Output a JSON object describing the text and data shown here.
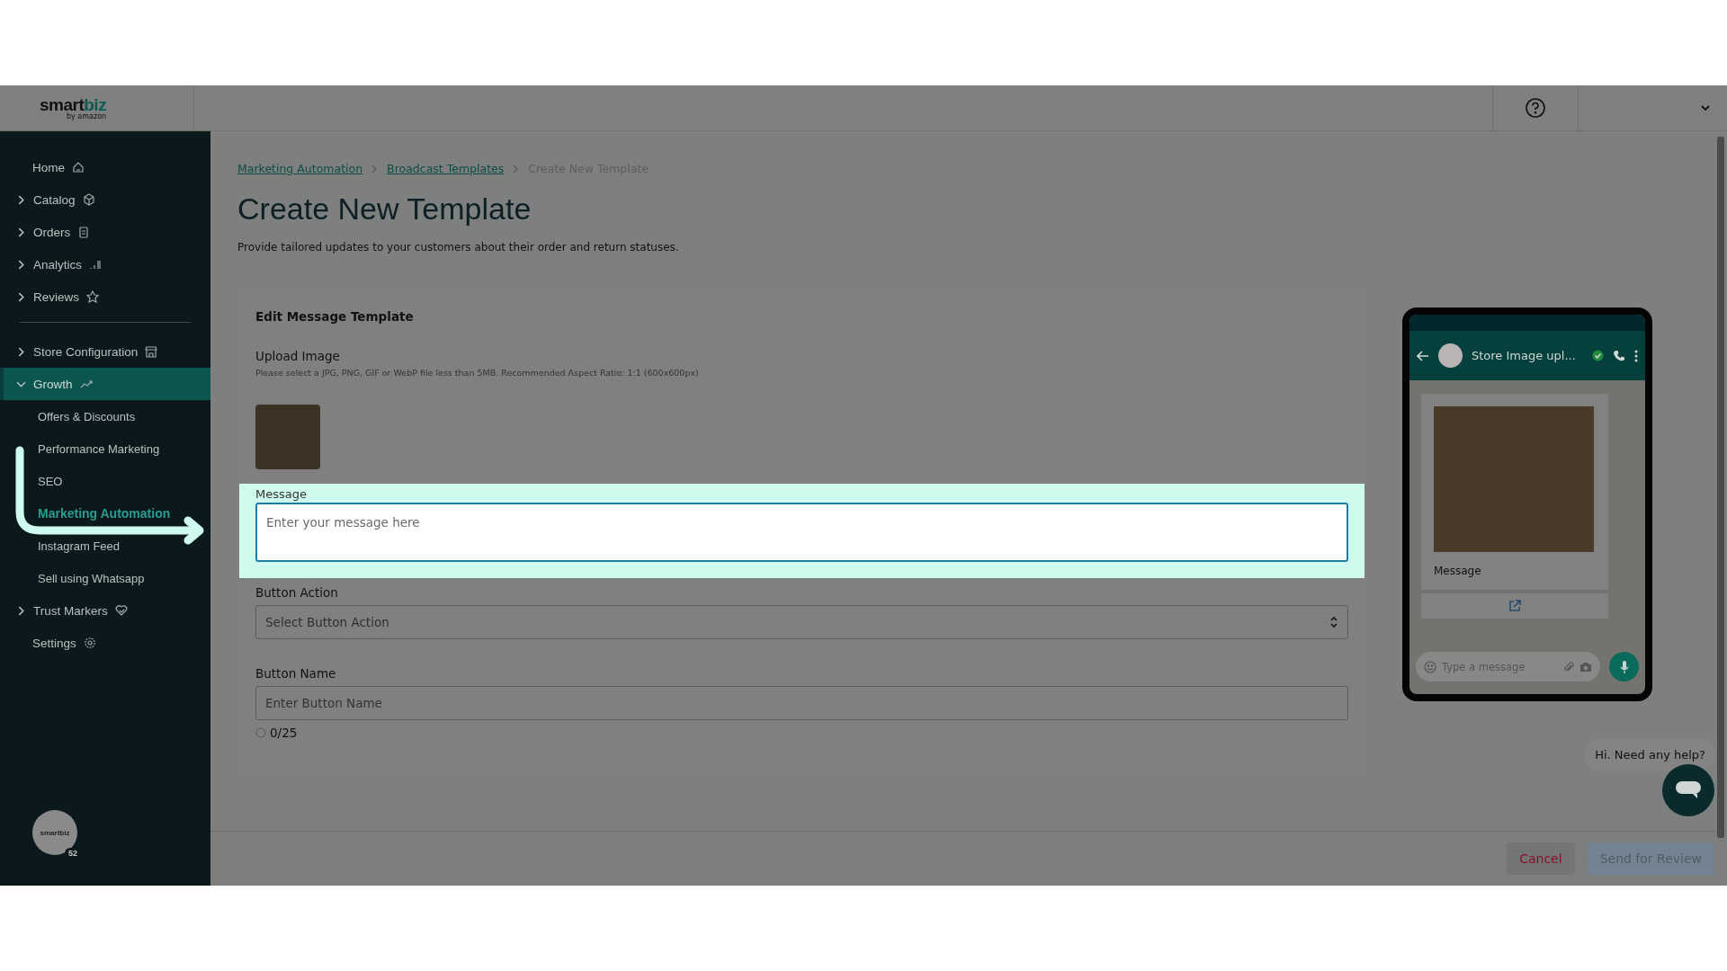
{
  "header": {
    "logo_parts": [
      "smart",
      "biz"
    ],
    "logo_tagline": "by amazon"
  },
  "sidebar": {
    "items": [
      {
        "label": "Home",
        "kind": "link",
        "selected": false
      },
      {
        "label": "Catalog",
        "kind": "group",
        "expanded": false,
        "selected": false
      },
      {
        "label": "Orders",
        "kind": "group",
        "expanded": false,
        "selected": false
      },
      {
        "label": "Analytics",
        "kind": "group",
        "expanded": false,
        "selected": false
      },
      {
        "label": "Reviews",
        "kind": "group",
        "expanded": false,
        "selected": false
      },
      {
        "kind": "divider"
      },
      {
        "label": "Store Configuration",
        "kind": "group",
        "expanded": false,
        "selected": false
      },
      {
        "label": "Growth",
        "kind": "group",
        "expanded": true,
        "selected": true,
        "children": [
          {
            "label": "Offers & Discounts",
            "selected": false
          },
          {
            "label": "Performance Marketing",
            "selected": false
          },
          {
            "label": "SEO",
            "selected": false
          },
          {
            "label": "Marketing Automation",
            "selected": true
          },
          {
            "label": "Instagram Feed",
            "selected": false
          },
          {
            "label": "Sell using Whatsapp",
            "selected": false
          }
        ]
      },
      {
        "label": "Trust Markers",
        "kind": "group",
        "expanded": false,
        "selected": false
      },
      {
        "label": "Settings",
        "kind": "link",
        "selected": false
      }
    ],
    "avatar_text": "smartbiz",
    "avatar_badge": "52"
  },
  "breadcrumb": [
    {
      "label": "Marketing Automation",
      "kind": "link"
    },
    {
      "label": "Broadcast Templates",
      "kind": "link"
    },
    {
      "label": "Create New Template",
      "kind": "current"
    }
  ],
  "title": "Create New Template",
  "description": "Provide tailored updates to your customers about their order and return statuses.",
  "form": {
    "heading": "Edit Message Template",
    "upload_label": "Upload Image",
    "upload_hint": "Please select a JPG, PNG, GIF or WebP file less than 5MB. Recommended Aspect Ratio: 1:1 (600x600px)",
    "message": {
      "label": "Message",
      "placeholder": "Enter your message here",
      "highlighted": true
    },
    "button_action": {
      "label": "Button Action",
      "placeholder": "Select Button Action"
    },
    "button_name": {
      "label": "Button Name",
      "placeholder": "Enter Button Name",
      "counter": "0/25"
    }
  },
  "preview": {
    "contact": "Store Image upl...",
    "verified": true,
    "message": "Message",
    "composer_placeholder": "Type a message"
  },
  "chat": {
    "bubble": "Hi. Need any help?"
  },
  "footer": {
    "buttons": [
      {
        "label": "Cancel",
        "kind": "secondary"
      },
      {
        "label": "Send for Review",
        "kind": "primary",
        "disabled": true
      }
    ]
  }
}
